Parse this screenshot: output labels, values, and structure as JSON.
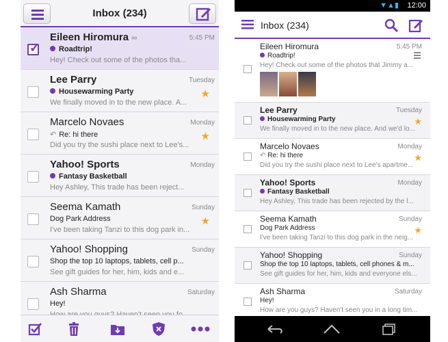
{
  "ios": {
    "title": "Inbox (234)",
    "emails": [
      {
        "sender": "Eileen Hiromura",
        "date": "5:45 PM",
        "subject": "Roadtrip!",
        "preview": "Hey! Check out some of the photos tha...",
        "unread": true,
        "selected": true,
        "starred": false,
        "dot": true,
        "attachment": true,
        "reply": false
      },
      {
        "sender": "Lee Parry",
        "date": "Tuesday",
        "subject": "Housewarming Party",
        "preview": "We finally moved in to the new place. A...",
        "unread": true,
        "selected": false,
        "starred": true,
        "dot": true,
        "attachment": false,
        "reply": false
      },
      {
        "sender": "Marcelo Novaes",
        "date": "Monday",
        "subject": "Re: hi there",
        "preview": "Did you try the sushi place next to Lee's...",
        "unread": false,
        "selected": false,
        "starred": true,
        "dot": false,
        "attachment": false,
        "reply": true
      },
      {
        "sender": "Yahoo! Sports",
        "date": "Monday",
        "subject": "Fantasy Basketball",
        "preview": "Hey Ashley, This trade has been reject...",
        "unread": true,
        "selected": false,
        "starred": false,
        "dot": true,
        "attachment": false,
        "reply": false
      },
      {
        "sender": "Seema Kamath",
        "date": "Sunday",
        "subject": "Dog Park Address",
        "preview": "I've been taking Tanzi to this dog park in...",
        "unread": false,
        "selected": false,
        "starred": true,
        "dot": false,
        "attachment": false,
        "reply": false
      },
      {
        "sender": "Yahoo! Shopping",
        "date": "Sunday",
        "subject": "Shop the top 10 laptops, tablets, cell p...",
        "preview": "See gift guides for her, him, kids and e...",
        "unread": false,
        "selected": false,
        "starred": false,
        "dot": false,
        "attachment": false,
        "reply": false
      },
      {
        "sender": "Ash Sharma",
        "date": "Saturday",
        "subject": "Hey!",
        "preview": "How are you guys? Haven't seen you fo...",
        "unread": false,
        "selected": false,
        "starred": false,
        "dot": false,
        "attachment": false,
        "reply": false
      }
    ],
    "toolbar": [
      "checkbox-icon",
      "trash-icon",
      "move-folder-icon",
      "spam-shield-icon",
      "more-icon"
    ]
  },
  "android": {
    "status_time": "12:00",
    "title": "Inbox (234)",
    "emails": [
      {
        "sender": "Eileen Hiromura",
        "date": "5:45 PM",
        "subject": "Roadtrip!",
        "preview": "Hey! Check out some of the photos that Jimmy a...",
        "unread": false,
        "starred": false,
        "dot": true,
        "reply": false,
        "thumbs": true
      },
      {
        "sender": "Lee Parry",
        "date": "Tuesday",
        "subject": "Housewarming Party",
        "preview": "We finally moved in to the new place. And we'd lo...",
        "unread": true,
        "starred": true,
        "dot": true,
        "reply": false,
        "thumbs": false
      },
      {
        "sender": "Marcelo Novaes",
        "date": "Monday",
        "subject": "Re: hi there",
        "preview": "Did you try the sushi place next to Lee's apartme...",
        "unread": false,
        "starred": true,
        "dot": false,
        "reply": true,
        "thumbs": false
      },
      {
        "sender": "Yahoo! Sports",
        "date": "Monday",
        "subject": "Fantasy Basketball",
        "preview": "Hey Ashley, This trade has been rejected by the l...",
        "unread": true,
        "starred": false,
        "dot": true,
        "reply": false,
        "thumbs": false
      },
      {
        "sender": "Seema Kamath",
        "date": "Sunday",
        "subject": "Dog Park Address",
        "preview": "I've been taking Tanzi to this dog park in the neig...",
        "unread": false,
        "starred": true,
        "dot": false,
        "reply": false,
        "thumbs": false
      },
      {
        "sender": "Yahoo! Shopping",
        "date": "Sunday",
        "subject": "Shop the top 10 laptops, tablets, cell phones & m...",
        "preview": "See gift guides for her, him, kids and everyone els...",
        "unread": false,
        "starred": false,
        "dot": false,
        "reply": false,
        "thumbs": false
      },
      {
        "sender": "Ash Sharma",
        "date": "Saturday",
        "subject": "Hey!",
        "preview": "How are you guys? Haven't seen you in a long tim...",
        "unread": false,
        "starred": false,
        "dot": false,
        "reply": false,
        "thumbs": false
      }
    ],
    "nav": [
      "back-icon",
      "home-icon",
      "recent-apps-icon"
    ]
  },
  "colors": {
    "accent": "#6f3bb4",
    "star": "#f5a623",
    "selected_row": "#e7e0f5"
  }
}
